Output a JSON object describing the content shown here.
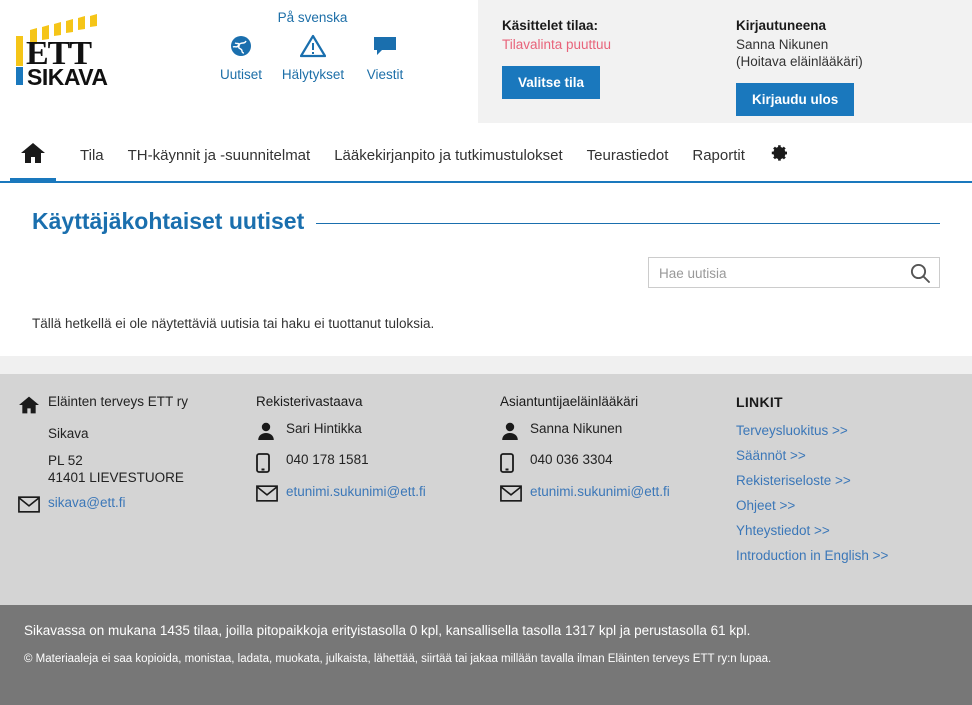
{
  "header": {
    "logo": {
      "brand_top": "ETT",
      "brand_bottom": "SIKAVA"
    },
    "language_link": "På svenska",
    "icons": [
      {
        "label": "Uutiset",
        "icon": "globe-icon"
      },
      {
        "label": "Hälytykset",
        "icon": "warning-triangle-icon"
      },
      {
        "label": "Viestit",
        "icon": "speech-bubble-icon"
      }
    ],
    "info_panel": {
      "farm_label": "Käsittelet tilaa:",
      "farm_value": "Tilavalinta puuttuu",
      "farm_button": "Valitse tila",
      "user_label": "Kirjautuneena",
      "user_name": "Sanna Nikunen",
      "user_role": "(Hoitava eläinlääkäri)",
      "logout_button": "Kirjaudu ulos"
    }
  },
  "nav": {
    "home_icon": "home-icon",
    "gear_icon": "gear-icon",
    "items": [
      "Tila",
      "TH-käynnit ja -suunnitelmat",
      "Lääkekirjanpito ja tutkimustulokset",
      "Teurastiedot",
      "Raportit"
    ]
  },
  "main": {
    "title": "Käyttäjäkohtaiset uutiset",
    "search": {
      "value": "",
      "placeholder": "Hae uutisia",
      "icon": "search-icon"
    },
    "empty_message": "Tällä hetkellä ei ole näytettäviä uutisia tai haku ei tuottanut tuloksia."
  },
  "footer": {
    "col1": {
      "icon": "home-icon",
      "org": "Eläinten terveys ETT ry",
      "service": "Sikava",
      "address_line1": "PL 52",
      "address_line2": "41401 LIEVESTUORE",
      "email_icon": "envelope-icon",
      "email": "sikava@ett.fi"
    },
    "col2": {
      "heading": "Rekisterivastaava",
      "person_icon": "person-icon",
      "person": "Sari Hintikka",
      "phone_icon": "mobile-phone-icon",
      "phone": "040 178 1581",
      "email_icon": "envelope-icon",
      "email": "etunimi.sukunimi@ett.fi"
    },
    "col3": {
      "heading": "Asiantuntijaeläinlääkäri",
      "person_icon": "person-icon",
      "person": "Sanna Nikunen",
      "phone_icon": "mobile-phone-icon",
      "phone": "040 036 3304",
      "email_icon": "envelope-icon",
      "email": "etunimi.sukunimi@ett.fi"
    },
    "col4": {
      "heading": "LINKIT",
      "links": [
        "Terveysluokitus >>",
        "Säännöt >>",
        "Rekisteriseloste >>",
        "Ohjeet >>",
        "Yhteystiedot >>",
        "Introduction in English >>"
      ]
    }
  },
  "statusbar": {
    "stats": "Sikavassa on mukana 1435 tilaa, joilla pitopaikkoja erityistasolla 0 kpl, kansallisella tasolla 1317 kpl ja perustasolla 61 kpl.",
    "copyright": "© Materiaaleja ei saa kopioida, monistaa, ladata, muokata, julkaista, lähettää, siirtää tai jakaa millään tavalla ilman Eläinten terveys ETT ry:n lupaa."
  },
  "colors": {
    "brand_blue": "#1a78bd",
    "title_blue": "#1a6fae",
    "link_blue": "#3b77b8",
    "warn_pink": "#e8637a",
    "footer_gray": "#d4d4d4",
    "status_gray": "#777777",
    "logo_yellow": "#f5c518"
  }
}
